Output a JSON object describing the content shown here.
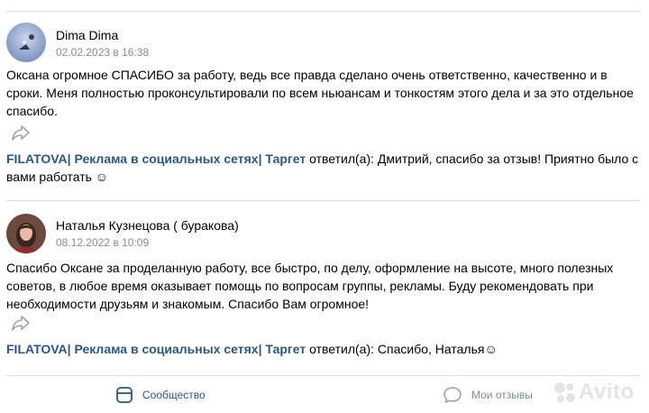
{
  "reviews": [
    {
      "author": "Dima Dima",
      "date": "02.02.2023 в 16:38",
      "text": "Оксана огромное СПАСИБО за работу, ведь все правда сделано очень ответственно, качественно и в сроки. Меня полностью проконсультировали по всем ньюансам и тонкостям этого дела и за это отдельное спасибо.",
      "reply_group": "FILATOVA| Реклама в социальных сетях| Таргет",
      "reply_text": " ответил(а): Дмитрий, спасибо за отзыв! Приятно было с вами работать ☺"
    },
    {
      "author": "Наталья Кузнецова ( буракова)",
      "date": "08.12.2022 в 10:09",
      "text": "Спасибо Оксане за проделанную работу, все быстро, по делу, оформление на высоте, много полезных советов, в любое время оказывает помощь по вопросам группы, рекламы. Буду рекомендовать при необходимости друзьям и знакомым. Спасибо Вам огромное!",
      "reply_group": "FILATOVA| Реклама в социальных сетях| Таргет",
      "reply_text": " ответил(а): Спасибо, Наталья☺"
    }
  ],
  "bottom_nav": {
    "community_label": "Сообщество",
    "my_reviews_label": "Мои отзывы"
  },
  "watermark": "Avito",
  "colors": {
    "link": "#2a5885",
    "secondary": "#818c99",
    "divider": "#dce1e6"
  }
}
